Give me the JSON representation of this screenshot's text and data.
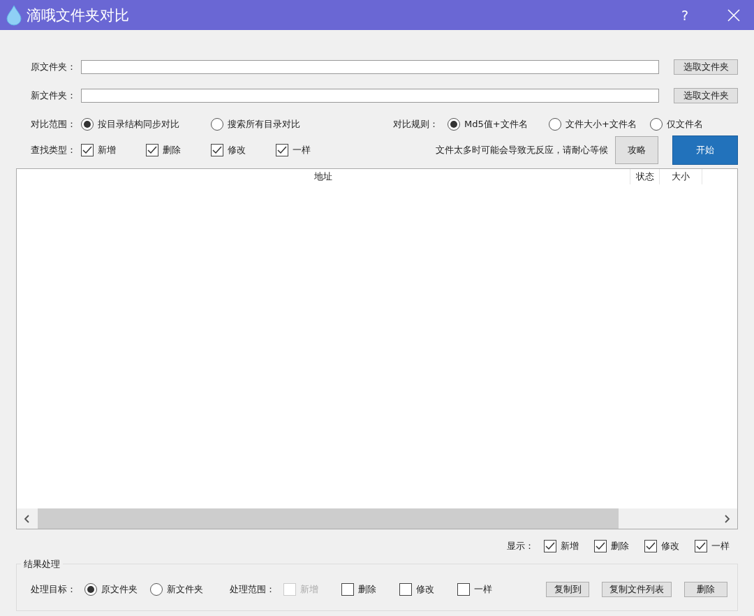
{
  "window": {
    "title": "滴哦文件夹对比",
    "help": "?"
  },
  "folders": [
    {
      "label": "原文件夹：",
      "button": "选取文件夹"
    },
    {
      "label": "新文件夹：",
      "button": "选取文件夹"
    }
  ],
  "compare_scope": {
    "label": "对比范围：",
    "options": [
      {
        "label": "按目录结构同步对比",
        "selected": true
      },
      {
        "label": "搜索所有目录对比",
        "selected": false
      }
    ]
  },
  "compare_rule": {
    "label": "对比规则：",
    "options": [
      {
        "label": "Md5值+文件名",
        "selected": true
      },
      {
        "label": "文件大小+文件名",
        "selected": false
      },
      {
        "label": "仅文件名",
        "selected": false
      }
    ]
  },
  "find_types": {
    "label": "查找类型：",
    "options": [
      {
        "label": "新增",
        "checked": true
      },
      {
        "label": "删除",
        "checked": true
      },
      {
        "label": "修改",
        "checked": true
      },
      {
        "label": "一样",
        "checked": true
      }
    ]
  },
  "notice": "文件太多时可能会导致无反应，请耐心等候",
  "guide_button": "攻略",
  "start_button": "开始",
  "table": {
    "columns": [
      "地址",
      "状态",
      "大小"
    ]
  },
  "show_filter": {
    "label": "显示：",
    "options": [
      {
        "label": "新增",
        "checked": true
      },
      {
        "label": "删除",
        "checked": true
      },
      {
        "label": "修改",
        "checked": true
      },
      {
        "label": "一样",
        "checked": true
      }
    ]
  },
  "result": {
    "title": "结果处理",
    "target": {
      "label": "处理目标：",
      "options": [
        {
          "label": "原文件夹",
          "selected": true
        },
        {
          "label": "新文件夹",
          "selected": false
        }
      ]
    },
    "scope": {
      "label": "处理范围：",
      "options": [
        {
          "label": "新增",
          "checked": false,
          "disabled": true
        },
        {
          "label": "删除",
          "checked": false,
          "disabled": false
        },
        {
          "label": "修改",
          "checked": false,
          "disabled": false
        },
        {
          "label": "一样",
          "checked": false,
          "disabled": false
        }
      ]
    },
    "actions": [
      "复制到",
      "复制文件列表",
      "删除"
    ]
  }
}
